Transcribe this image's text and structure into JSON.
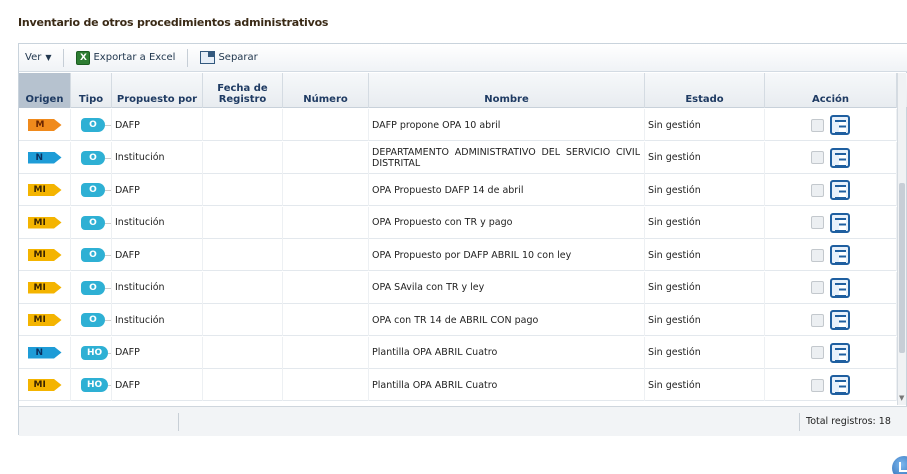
{
  "page": {
    "title": "Inventario de otros procedimientos administrativos"
  },
  "toolbar": {
    "ver_label": "Ver",
    "exportar_label": "Exportar a Excel",
    "separar_label": "Separar"
  },
  "columns": {
    "origen": "Origen",
    "tipo": "Tipo",
    "propuesto_por": "Propuesto por",
    "fecha_registro": "Fecha de Registro",
    "numero": "Número",
    "nombre": "Nombre",
    "estado": "Estado",
    "accion": "Acción"
  },
  "rows": [
    {
      "origen": "M",
      "tipo": "O",
      "propuesto": "DAFP",
      "fecha": "",
      "numero": "",
      "nombre": "DAFP propone OPA 10 abril",
      "estado": "Sin gestión"
    },
    {
      "origen": "N",
      "tipo": "O",
      "propuesto": "Institución",
      "fecha": "",
      "numero": "",
      "nombre": "DEPARTAMENTO ADMINISTRATIVO DEL SERVICIO CIVIL DISTRITAL",
      "estado": "Sin gestión"
    },
    {
      "origen": "MI",
      "tipo": "O",
      "propuesto": "DAFP",
      "fecha": "",
      "numero": "",
      "nombre": "OPA Propuesto DAFP 14 de abril",
      "estado": "Sin gestión"
    },
    {
      "origen": "MI",
      "tipo": "O",
      "propuesto": "Institución",
      "fecha": "",
      "numero": "",
      "nombre": "OPA Propuesto con TR y pago",
      "estado": "Sin gestión"
    },
    {
      "origen": "MI",
      "tipo": "O",
      "propuesto": "DAFP",
      "fecha": "",
      "numero": "",
      "nombre": "OPA Propuesto por DAFP ABRIL 10 con ley",
      "estado": "Sin gestión"
    },
    {
      "origen": "MI",
      "tipo": "O",
      "propuesto": "Institución",
      "fecha": "",
      "numero": "",
      "nombre": "OPA SAvila con TR y ley",
      "estado": "Sin gestión"
    },
    {
      "origen": "MI",
      "tipo": "O",
      "propuesto": "Institución",
      "fecha": "",
      "numero": "",
      "nombre": "OPA con TR 14 de ABRIL CON pago",
      "estado": "Sin gestión"
    },
    {
      "origen": "N",
      "tipo": "HO",
      "propuesto": "DAFP",
      "fecha": "",
      "numero": "",
      "nombre": "Plantilla OPA ABRIL Cuatro",
      "estado": "Sin gestión"
    },
    {
      "origen": "MI",
      "tipo": "HO",
      "propuesto": "DAFP",
      "fecha": "",
      "numero": "",
      "nombre": "Plantilla OPA ABRIL Cuatro",
      "estado": "Sin gestión"
    }
  ],
  "footer": {
    "total_label": "Total registros: 18"
  },
  "colors": {
    "origen_M": "#f08a1c",
    "origen_N": "#1e9cd7",
    "origen_MI": "#f4b400",
    "tipo": "#2eb0d4",
    "header_text": "#1f3b63",
    "accent_blue": "#1f5fa0"
  },
  "icons": {
    "ver": "chevron-down-icon",
    "exportar": "excel-icon",
    "separar": "detach-icon",
    "accion_check": "checkbox-icon",
    "accion_detail": "detail-icon",
    "corner": "home-icon"
  }
}
